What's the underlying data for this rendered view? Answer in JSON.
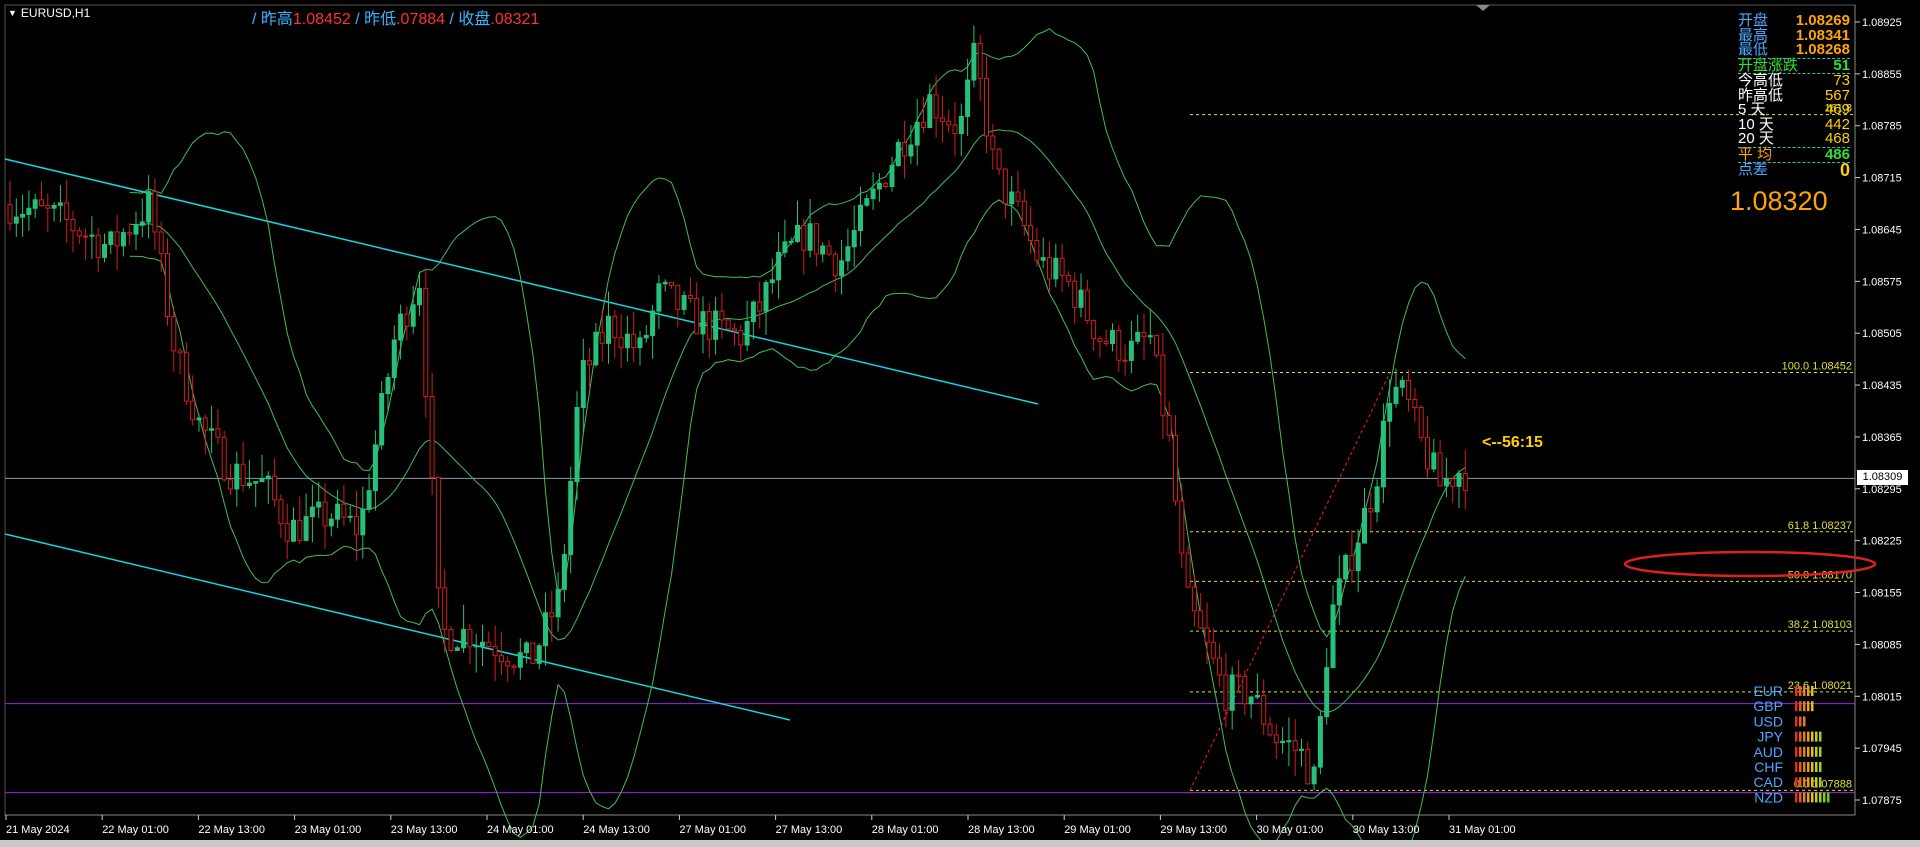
{
  "header": {
    "symbol": "EURUSD,H1",
    "prev_high_label": "/ 昨高",
    "prev_high_value": "1.08452",
    "prev_low_label": "/ 昨低",
    "prev_low_value": ".07884",
    "close_label": "/ 收盘",
    "close_value": ".08321"
  },
  "info_panel": {
    "open_label": "开盘",
    "open_value": "1.08269",
    "high_label": "最高",
    "high_value": "1.08341",
    "low_label": "最低",
    "low_value": "1.08268",
    "change_label": "开盘涨跌",
    "change_value": "51",
    "rows": [
      {
        "label": "今高低",
        "value": "73"
      },
      {
        "label": "昨高低",
        "value": "567"
      },
      {
        "label": "5   天",
        "value": "469"
      },
      {
        "label": "10  天",
        "value": "442"
      },
      {
        "label": "20  天",
        "value": "468"
      }
    ],
    "avg_label": "平  均",
    "avg_value": "486",
    "spread_label": "点差",
    "spread_value": "0",
    "big_price": "1.08320"
  },
  "countdown": "<--56:15",
  "current_price_label": "1.08309",
  "currency_strength": [
    {
      "name": "EUR",
      "bars": 5
    },
    {
      "name": "GBP",
      "bars": 5
    },
    {
      "name": "USD",
      "bars": 3
    },
    {
      "name": "JPY",
      "bars": 7
    },
    {
      "name": "AUD",
      "bars": 7
    },
    {
      "name": "CHF",
      "bars": 7
    },
    {
      "name": "CAD",
      "bars": 7
    },
    {
      "name": "NZD",
      "bars": 9
    }
  ],
  "colors": {
    "bull": "#26c07a",
    "bear": "#d01e1e",
    "band": "#3fbf55",
    "channel": "#10d8e0",
    "fib": "#e0e030",
    "purple": "#a020f0",
    "axis": "#ffffff",
    "red_ellipse": "#e02020"
  },
  "chart_data": {
    "type": "candlestick",
    "symbol": "EURUSD",
    "timeframe": "H1",
    "y_ticks": [
      "1.08925",
      "1.08855",
      "1.08785",
      "1.08715",
      "1.08645",
      "1.08575",
      "1.08505",
      "1.08435",
      "1.08365",
      "1.08295",
      "1.08225",
      "1.08155",
      "1.08085",
      "1.08015",
      "1.07945",
      "1.07875"
    ],
    "ylim": [
      1.07855,
      1.08945
    ],
    "x_ticks": [
      "21 May 2024",
      "22 May 01:00",
      "22 May 13:00",
      "23 May 01:00",
      "23 May 13:00",
      "24 May 01:00",
      "24 May 13:00",
      "27 May 01:00",
      "27 May 13:00",
      "28 May 01:00",
      "28 May 13:00",
      "29 May 01:00",
      "29 May 13:00",
      "30 May 01:00",
      "30 May 13:00",
      "31 May 01:00"
    ],
    "fib_levels": [
      {
        "pct": "100.0",
        "price": "1.08452",
        "value": 1.08452
      },
      {
        "pct": "61.8",
        "price": "1.08237",
        "value": 1.08237
      },
      {
        "pct": "50.0",
        "price": "1.08170",
        "value": 1.0817
      },
      {
        "pct": "38.2",
        "price": "1.08103",
        "value": 1.08103
      },
      {
        "pct": "23.6",
        "price": "1.08021",
        "value": 1.08021
      },
      {
        "pct": "0.0",
        "price": "1.07888",
        "value": 1.07888
      }
    ],
    "fib_extension": {
      "pct": "161.8",
      "value": 1.088
    },
    "horizontal_lines": {
      "current_price": 1.08309,
      "support_1": 1.08005,
      "support_2": 1.07885
    },
    "key_points": [
      {
        "x": "21 May 2024",
        "close": 1.0868
      },
      {
        "x": "22 May 13:00",
        "close": 1.084
      },
      {
        "x": "23 May 01:00",
        "close": 1.0826
      },
      {
        "x": "23 May 13:00",
        "close": 1.0855
      },
      {
        "x": "24 May 01:00",
        "close": 1.0808
      },
      {
        "x": "24 May 13:00",
        "close": 1.0848
      },
      {
        "x": "27 May 13:00",
        "close": 1.0857
      },
      {
        "x": "28 May 01:00",
        "close": 1.0878
      },
      {
        "x": "28 May 13:00",
        "close": 1.0868
      },
      {
        "x": "29 May 01:00",
        "close": 1.0855
      },
      {
        "x": "29 May 13:00",
        "close": 1.0812
      },
      {
        "x": "30 May 01:00",
        "close": 1.0791
      },
      {
        "x": "30 May 13:00",
        "close": 1.0839
      },
      {
        "x": "31 May 01:00",
        "close": 1.0831
      }
    ]
  }
}
